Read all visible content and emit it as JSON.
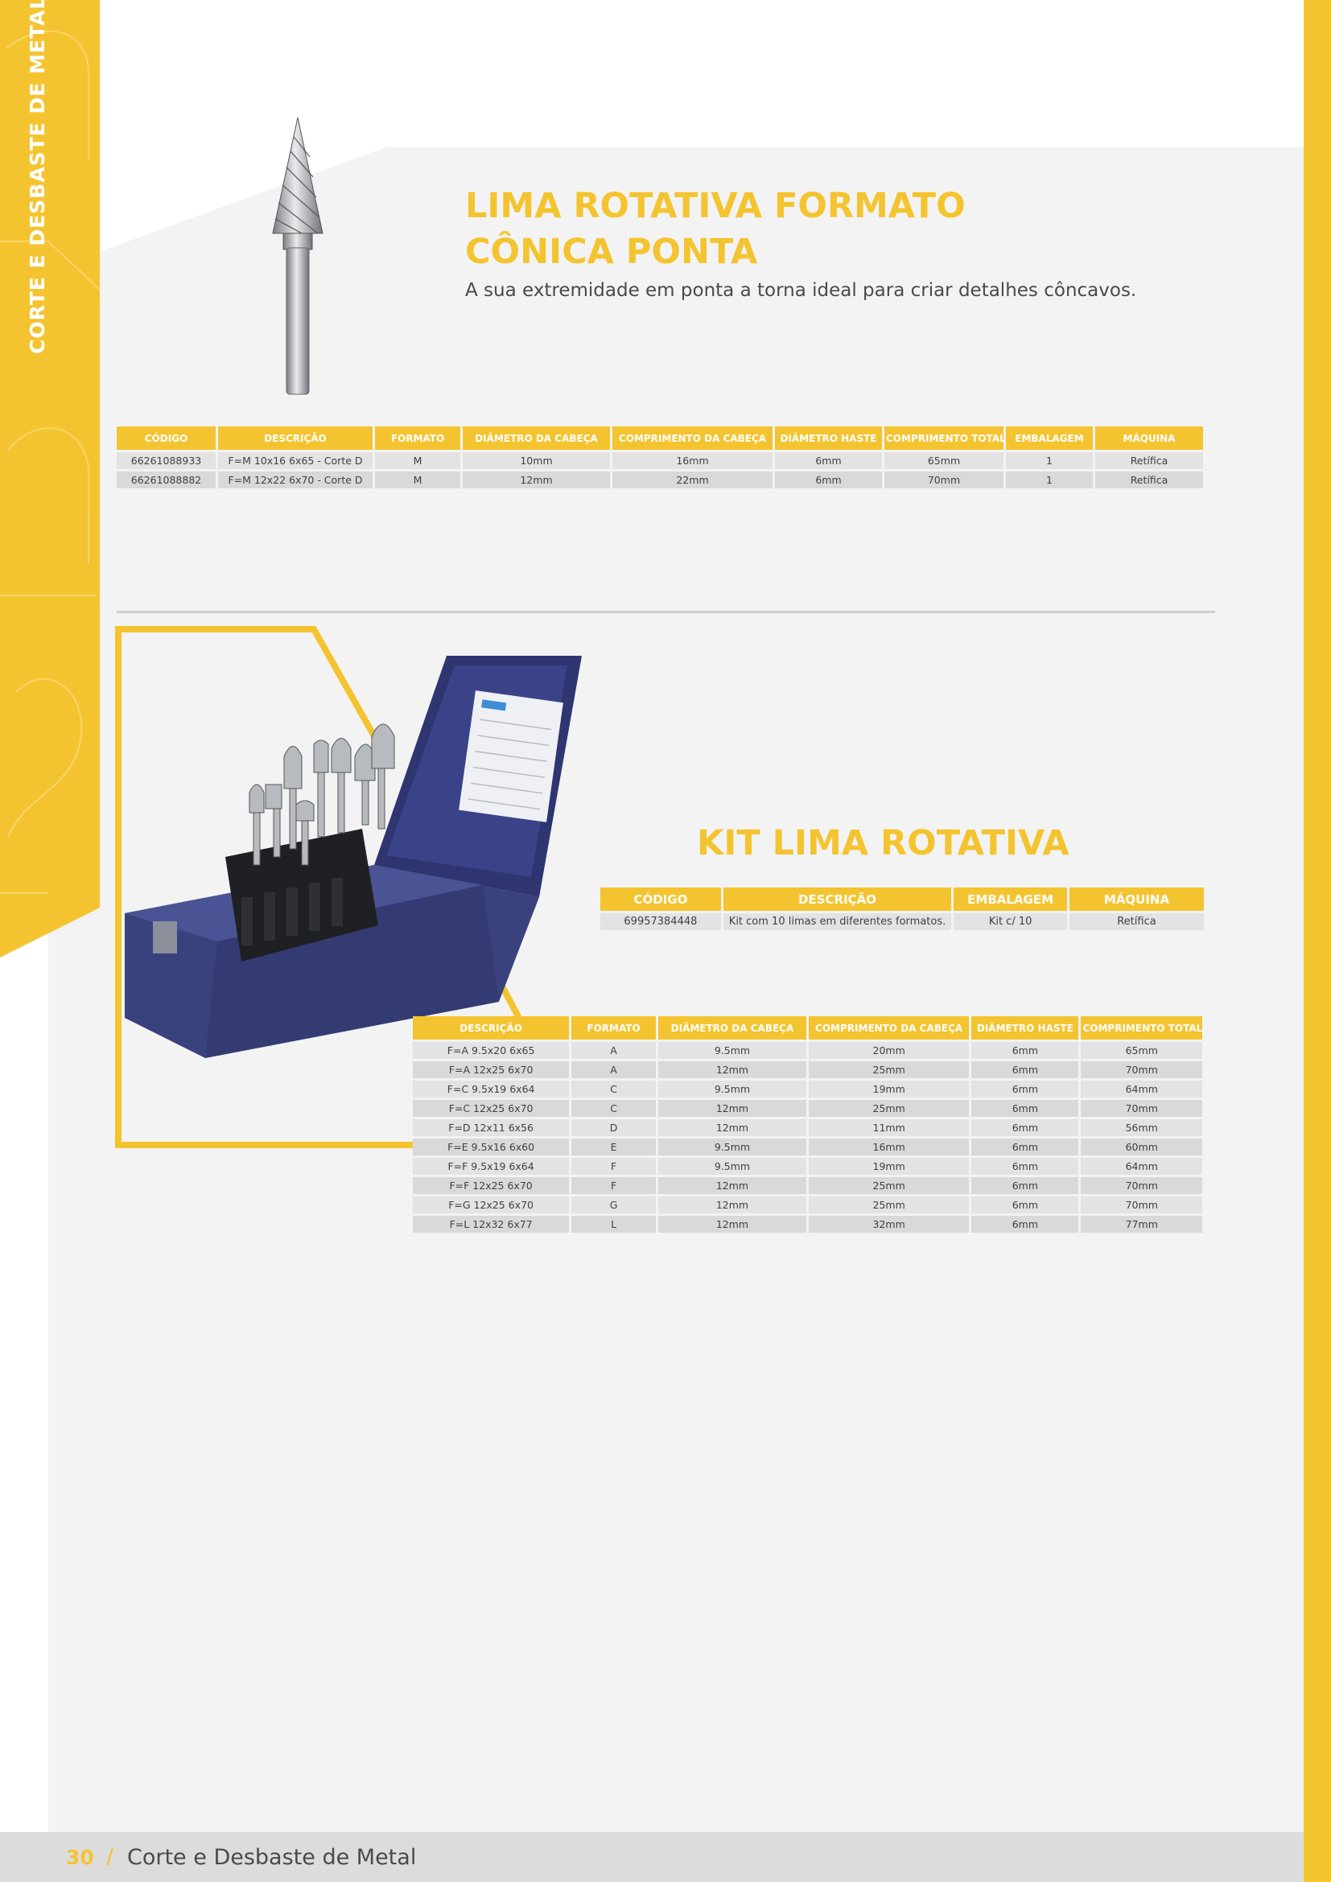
{
  "side_title": "CORTE E DESBASTE DE METAL",
  "colors": {
    "accent": "#f4c430",
    "panel": "#f3f3f3",
    "case_blue": "#2f3570"
  },
  "product1": {
    "title_line1": "LIMA ROTATIVA FORMATO",
    "title_line2": "CÔNICA PONTA",
    "description": "A sua extremidade em ponta a torna ideal para criar detalhes côncavos.",
    "image_icon": "conical-burr-tool",
    "headers": [
      "CÓDIGO",
      "DESCRIÇÃO",
      "FORMATO",
      "DIÂMETRO DA CABEÇA",
      "COMPRIMENTO DA CABEÇA",
      "DIÂMETRO HASTE",
      "COMPRIMENTO TOTAL",
      "EMBALAGEM",
      "MÁQUINA"
    ],
    "rows": [
      [
        "66261088933",
        "F=M 10x16 6x65 - Corte D",
        "M",
        "10mm",
        "16mm",
        "6mm",
        "65mm",
        "1",
        "Retífica"
      ],
      [
        "66261088882",
        "F=M 12x22 6x70 - Corte D",
        "M",
        "12mm",
        "22mm",
        "6mm",
        "70mm",
        "1",
        "Retífica"
      ]
    ]
  },
  "product2": {
    "title": "KIT LIMA ROTATIVA",
    "image_icon": "burr-kit-case",
    "kit_headers": [
      "CÓDIGO",
      "DESCRIÇÃO",
      "EMBALAGEM",
      "MÁQUINA"
    ],
    "kit_row": [
      "69957384448",
      "Kit com 10 limas em diferentes formatos.",
      "Kit c/ 10",
      "Retífica"
    ],
    "headers": [
      "DESCRIÇÃO",
      "FORMATO",
      "DIÂMETRO DA CABEÇA",
      "COMPRIMENTO DA CABEÇA",
      "DIÂMETRO HASTE",
      "COMPRIMENTO TOTAL"
    ],
    "rows": [
      [
        "F=A 9.5x20 6x65",
        "A",
        "9.5mm",
        "20mm",
        "6mm",
        "65mm"
      ],
      [
        "F=A 12x25 6x70",
        "A",
        "12mm",
        "25mm",
        "6mm",
        "70mm"
      ],
      [
        "F=C 9.5x19 6x64",
        "C",
        "9.5mm",
        "19mm",
        "6mm",
        "64mm"
      ],
      [
        "F=C 12x25 6x70",
        "C",
        "12mm",
        "25mm",
        "6mm",
        "70mm"
      ],
      [
        "F=D 12x11 6x56",
        "D",
        "12mm",
        "11mm",
        "6mm",
        "56mm"
      ],
      [
        "F=E 9.5x16 6x60",
        "E",
        "9.5mm",
        "16mm",
        "6mm",
        "60mm"
      ],
      [
        "F=F 9.5x19 6x64",
        "F",
        "9.5mm",
        "19mm",
        "6mm",
        "64mm"
      ],
      [
        "F=F 12x25 6x70",
        "F",
        "12mm",
        "25mm",
        "6mm",
        "70mm"
      ],
      [
        "F=G 12x25 6x70",
        "G",
        "12mm",
        "25mm",
        "6mm",
        "70mm"
      ],
      [
        "F=L 12x32 6x77",
        "L",
        "12mm",
        "32mm",
        "6mm",
        "77mm"
      ]
    ]
  },
  "footer": {
    "page_number": "30",
    "separator": "/",
    "section": "Corte e Desbaste de Metal"
  }
}
